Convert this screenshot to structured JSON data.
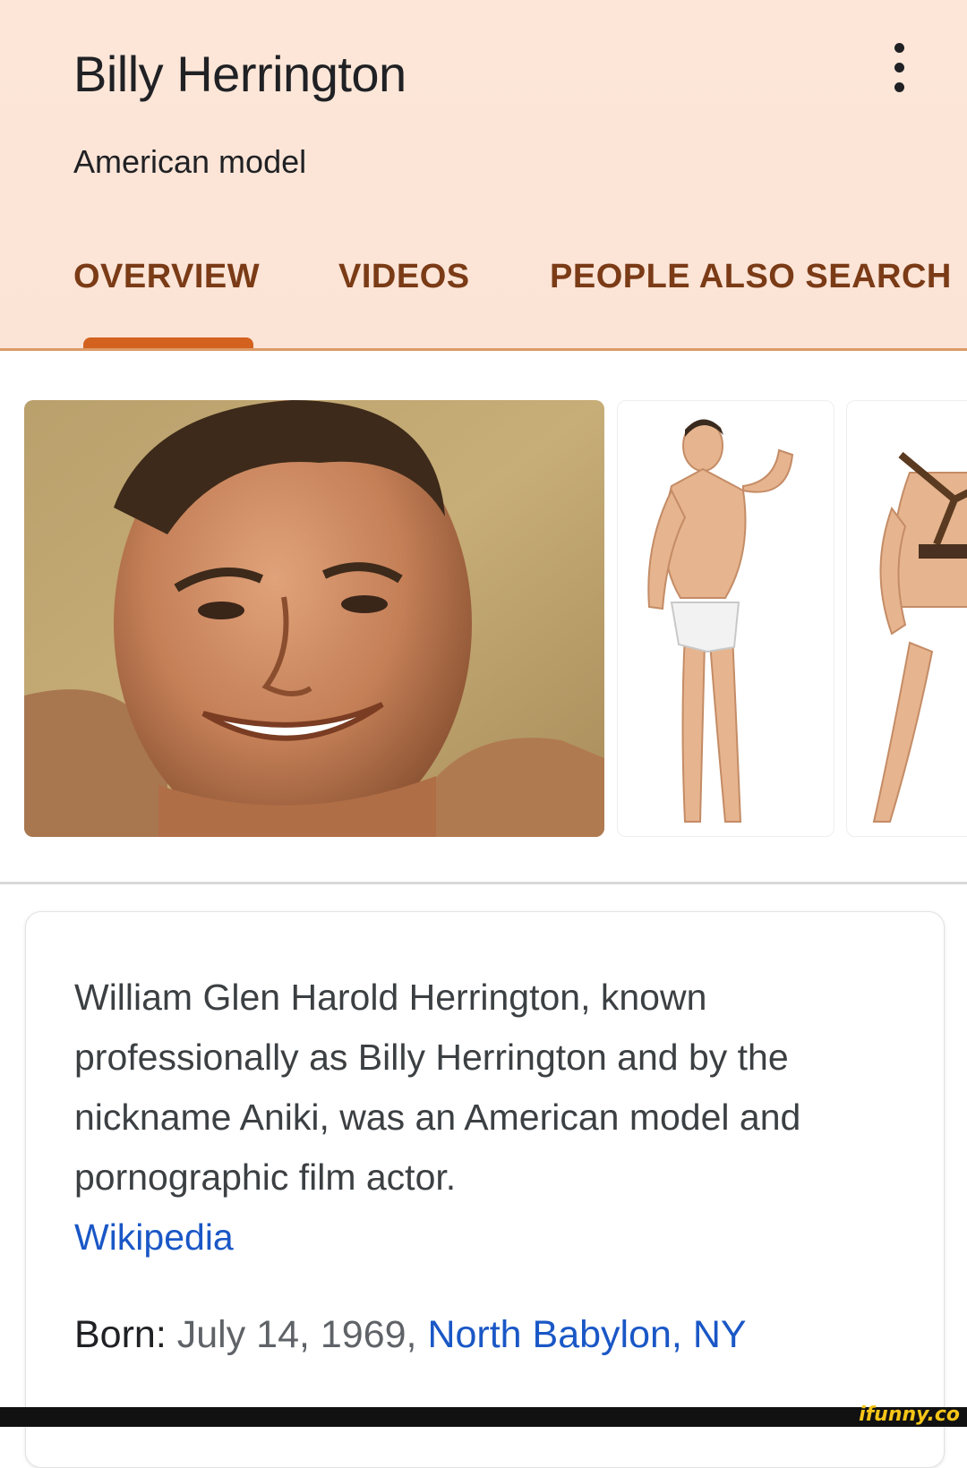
{
  "header": {
    "title": "Billy Herrington",
    "subtitle": "American model",
    "tabs": [
      {
        "label": "OVERVIEW",
        "active": true
      },
      {
        "label": "VIDEOS",
        "active": false
      },
      {
        "label": "PEOPLE ALSO SEARCH",
        "active": false
      }
    ],
    "menu_icon": "more-vert-icon"
  },
  "images": [
    {
      "kind": "portrait photo"
    },
    {
      "kind": "action figure flexing"
    },
    {
      "kind": "action figure partial"
    }
  ],
  "card": {
    "description": "William Glen Harold Herrington, known professionally as Billy Herrington and by the nickname Aniki, was an American model and pornographic film actor.",
    "source_link": "Wikipedia",
    "born_label": "Born:",
    "born_date": "July 14, 1969,",
    "born_place": "North Babylon, NY"
  },
  "watermark": "ifunny.co",
  "colors": {
    "header_bg": "#fde6d8",
    "tab_text": "#7a3b16",
    "tab_indicator": "#d3621f",
    "link": "#1a57c6"
  }
}
